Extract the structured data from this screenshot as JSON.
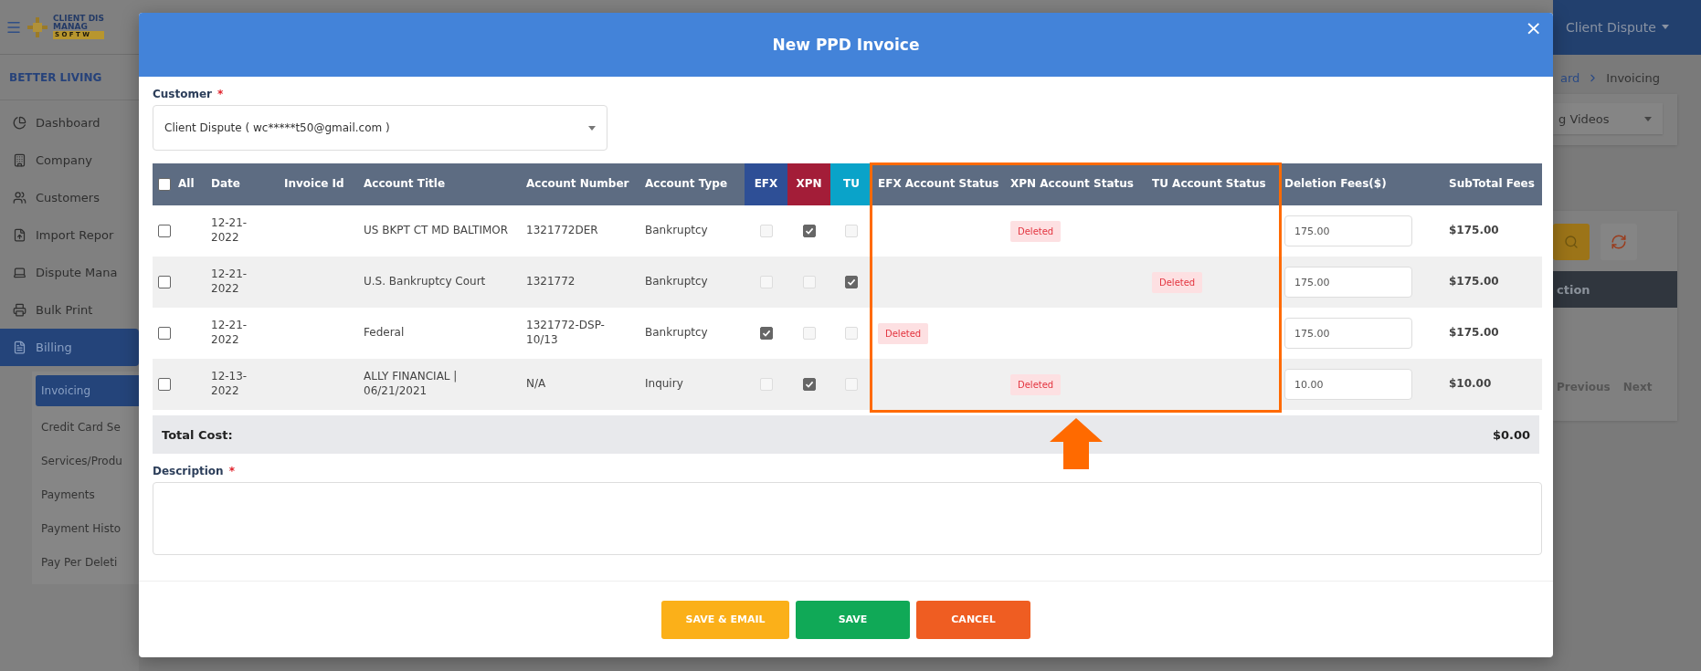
{
  "app": {
    "logo_lines": [
      "CLIENT DIS",
      "MANAG",
      "S O F T W"
    ],
    "org": "BETTER LIVING",
    "user": "Client Dispute"
  },
  "sidebar": {
    "items": [
      {
        "label": "Dashboard",
        "selected": false
      },
      {
        "label": "Company",
        "selected": false
      },
      {
        "label": "Customers",
        "selected": false
      },
      {
        "label": "Import Repor",
        "selected": false
      },
      {
        "label": "Dispute Mana",
        "selected": false
      },
      {
        "label": "Bulk Print",
        "selected": false
      },
      {
        "label": "Billing",
        "selected": true,
        "children": [
          {
            "label": "Invoicing",
            "selected": true
          },
          {
            "label": "Credit Card Se",
            "selected": false
          },
          {
            "label": "Services/Produ",
            "selected": false
          },
          {
            "label": "Payments",
            "selected": false
          },
          {
            "label": "Payment Histo",
            "selected": false
          },
          {
            "label": "Pay Per Deleti",
            "selected": false
          }
        ]
      }
    ]
  },
  "right_panel": {
    "breadcrumb": [
      "ard",
      "Invoicing"
    ],
    "dropdown": "g Videos",
    "action_bar": "ction",
    "pager": [
      "Previous",
      "Next"
    ]
  },
  "modal": {
    "title": "New PPD Invoice",
    "close": "×",
    "customer": {
      "label": "Customer",
      "required_mark": "*",
      "value": "Client Dispute ( wc*****t50@gmail.com )"
    },
    "table": {
      "all_checked": false,
      "columns": [
        {
          "label": "All"
        },
        {
          "label": "Date"
        },
        {
          "label": "Invoice Id"
        },
        {
          "label": "Account Title"
        },
        {
          "label": "Account Number"
        },
        {
          "label": "Account Type"
        },
        {
          "label": "EFX",
          "color": "#2e4f96"
        },
        {
          "label": "XPN",
          "color": "#a31d38"
        },
        {
          "label": "TU",
          "color": "#0aa3c9"
        },
        {
          "label": "EFX Account Status"
        },
        {
          "label": "XPN Account Status"
        },
        {
          "label": "TU Account Status"
        },
        {
          "label": "Deletion Fees($)"
        },
        {
          "label": "SubTotal Fees"
        }
      ],
      "rows": [
        {
          "selected": false,
          "date": "12-21-2022",
          "title": "US BKPT CT MD BALTIMOR",
          "number": "1321772DER",
          "type": "Bankruptcy",
          "efx": false,
          "xpn": true,
          "tu": false,
          "xpn_status": "Deleted",
          "fee": "175.00",
          "subtotal": "$175.00"
        },
        {
          "selected": false,
          "date": "12-21-2022",
          "title": "U.S. Bankruptcy Court",
          "number": "1321772",
          "type": "Bankruptcy",
          "efx": false,
          "xpn": false,
          "tu": true,
          "tu_status": "Deleted",
          "fee": "175.00",
          "subtotal": "$175.00"
        },
        {
          "selected": false,
          "date": "12-21-2022",
          "title": "Federal",
          "number": "1321772-DSP-10/13",
          "type": "Bankruptcy",
          "efx": true,
          "xpn": false,
          "tu": false,
          "efx_status": "Deleted",
          "fee": "175.00",
          "subtotal": "$175.00"
        },
        {
          "selected": false,
          "date": "12-13-2022",
          "title": "ALLY FINANCIAL | 06/21/2021",
          "number": "N/A",
          "type": "Inquiry",
          "efx": false,
          "xpn": true,
          "tu": false,
          "xpn_status": "Deleted",
          "fee": "10.00",
          "subtotal": "$10.00"
        }
      ],
      "total_label": "Total Cost:",
      "total": "$0.00"
    },
    "description": {
      "label": "Description",
      "required_mark": "*"
    },
    "buttons": [
      {
        "label": "SAVE & EMAIL",
        "kind": "warning"
      },
      {
        "label": "SAVE",
        "kind": "success"
      },
      {
        "label": "CANCEL",
        "kind": "danger"
      }
    ]
  }
}
